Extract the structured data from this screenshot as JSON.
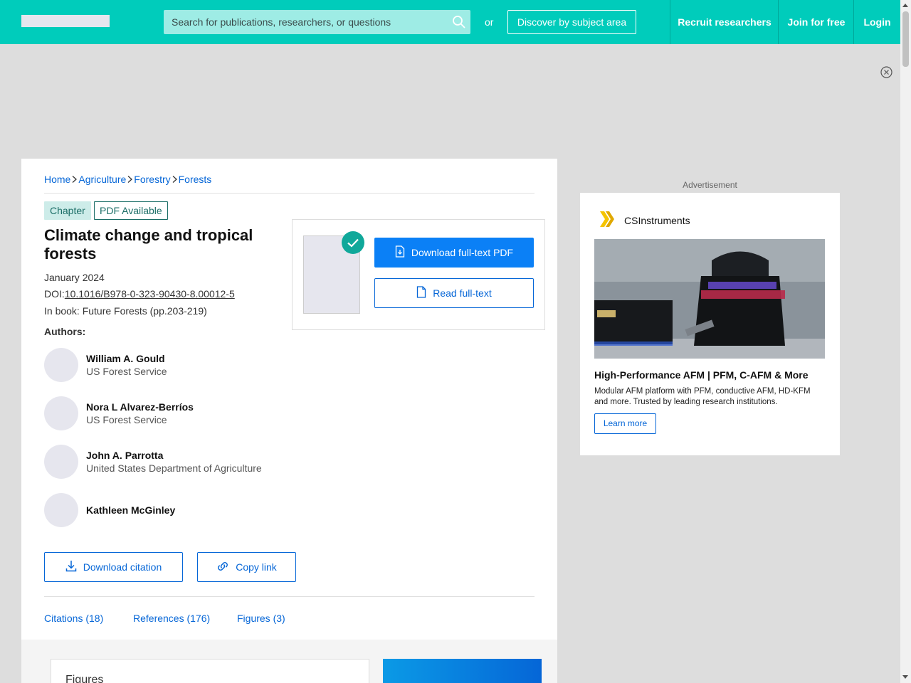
{
  "topbar": {
    "search_placeholder": "Search for publications, researchers, or questions",
    "or_text": "or",
    "discover_label": "Discover by subject area",
    "recruit_label": "Recruit researchers",
    "join_label": "Join for free",
    "login_label": "Login"
  },
  "breadcrumb": [
    "Home",
    "Agriculture",
    "Forestry",
    "Forests"
  ],
  "tags": {
    "type": "Chapter",
    "availability": "PDF Available"
  },
  "publication": {
    "title": "Climate change and tropical forests",
    "date": "January 2024",
    "doi_prefix": "DOI:",
    "doi": "10.1016/B978-0-323-90430-8.00012-5",
    "book": "In book: Future Forests (pp.203-219)",
    "authors_label": "Authors:"
  },
  "authors": [
    {
      "name": "William A. Gould",
      "affiliation": "US Forest Service"
    },
    {
      "name": "Nora L Alvarez-Berríos",
      "affiliation": "US Forest Service"
    },
    {
      "name": "John A. Parrotta",
      "affiliation": "United States Department of Agriculture"
    },
    {
      "name": "Kathleen McGinley",
      "affiliation": ""
    }
  ],
  "actions": {
    "download_pdf": "Download full-text PDF",
    "read_fulltext": "Read full-text",
    "download_citation": "Download citation",
    "copy_link": "Copy link"
  },
  "tabs": [
    "Citations (18)",
    "References (176)",
    "Figures (3)"
  ],
  "figures_heading": "Figures",
  "ad": {
    "label": "Advertisement",
    "brand": "CSInstruments",
    "headline": "High-Performance AFM | PFM, C-AFM & More",
    "body": "Modular AFM platform with PFM, conductive AFM, HD-KFM and more. Trusted by leading research institutions.",
    "cta": "Learn more"
  },
  "colors": {
    "topbar": "#00ccbb",
    "link": "#0566d7",
    "primary_button": "#0b80f6",
    "tag_teal": "#1a6d66",
    "ad_logo": "#f5c400"
  }
}
